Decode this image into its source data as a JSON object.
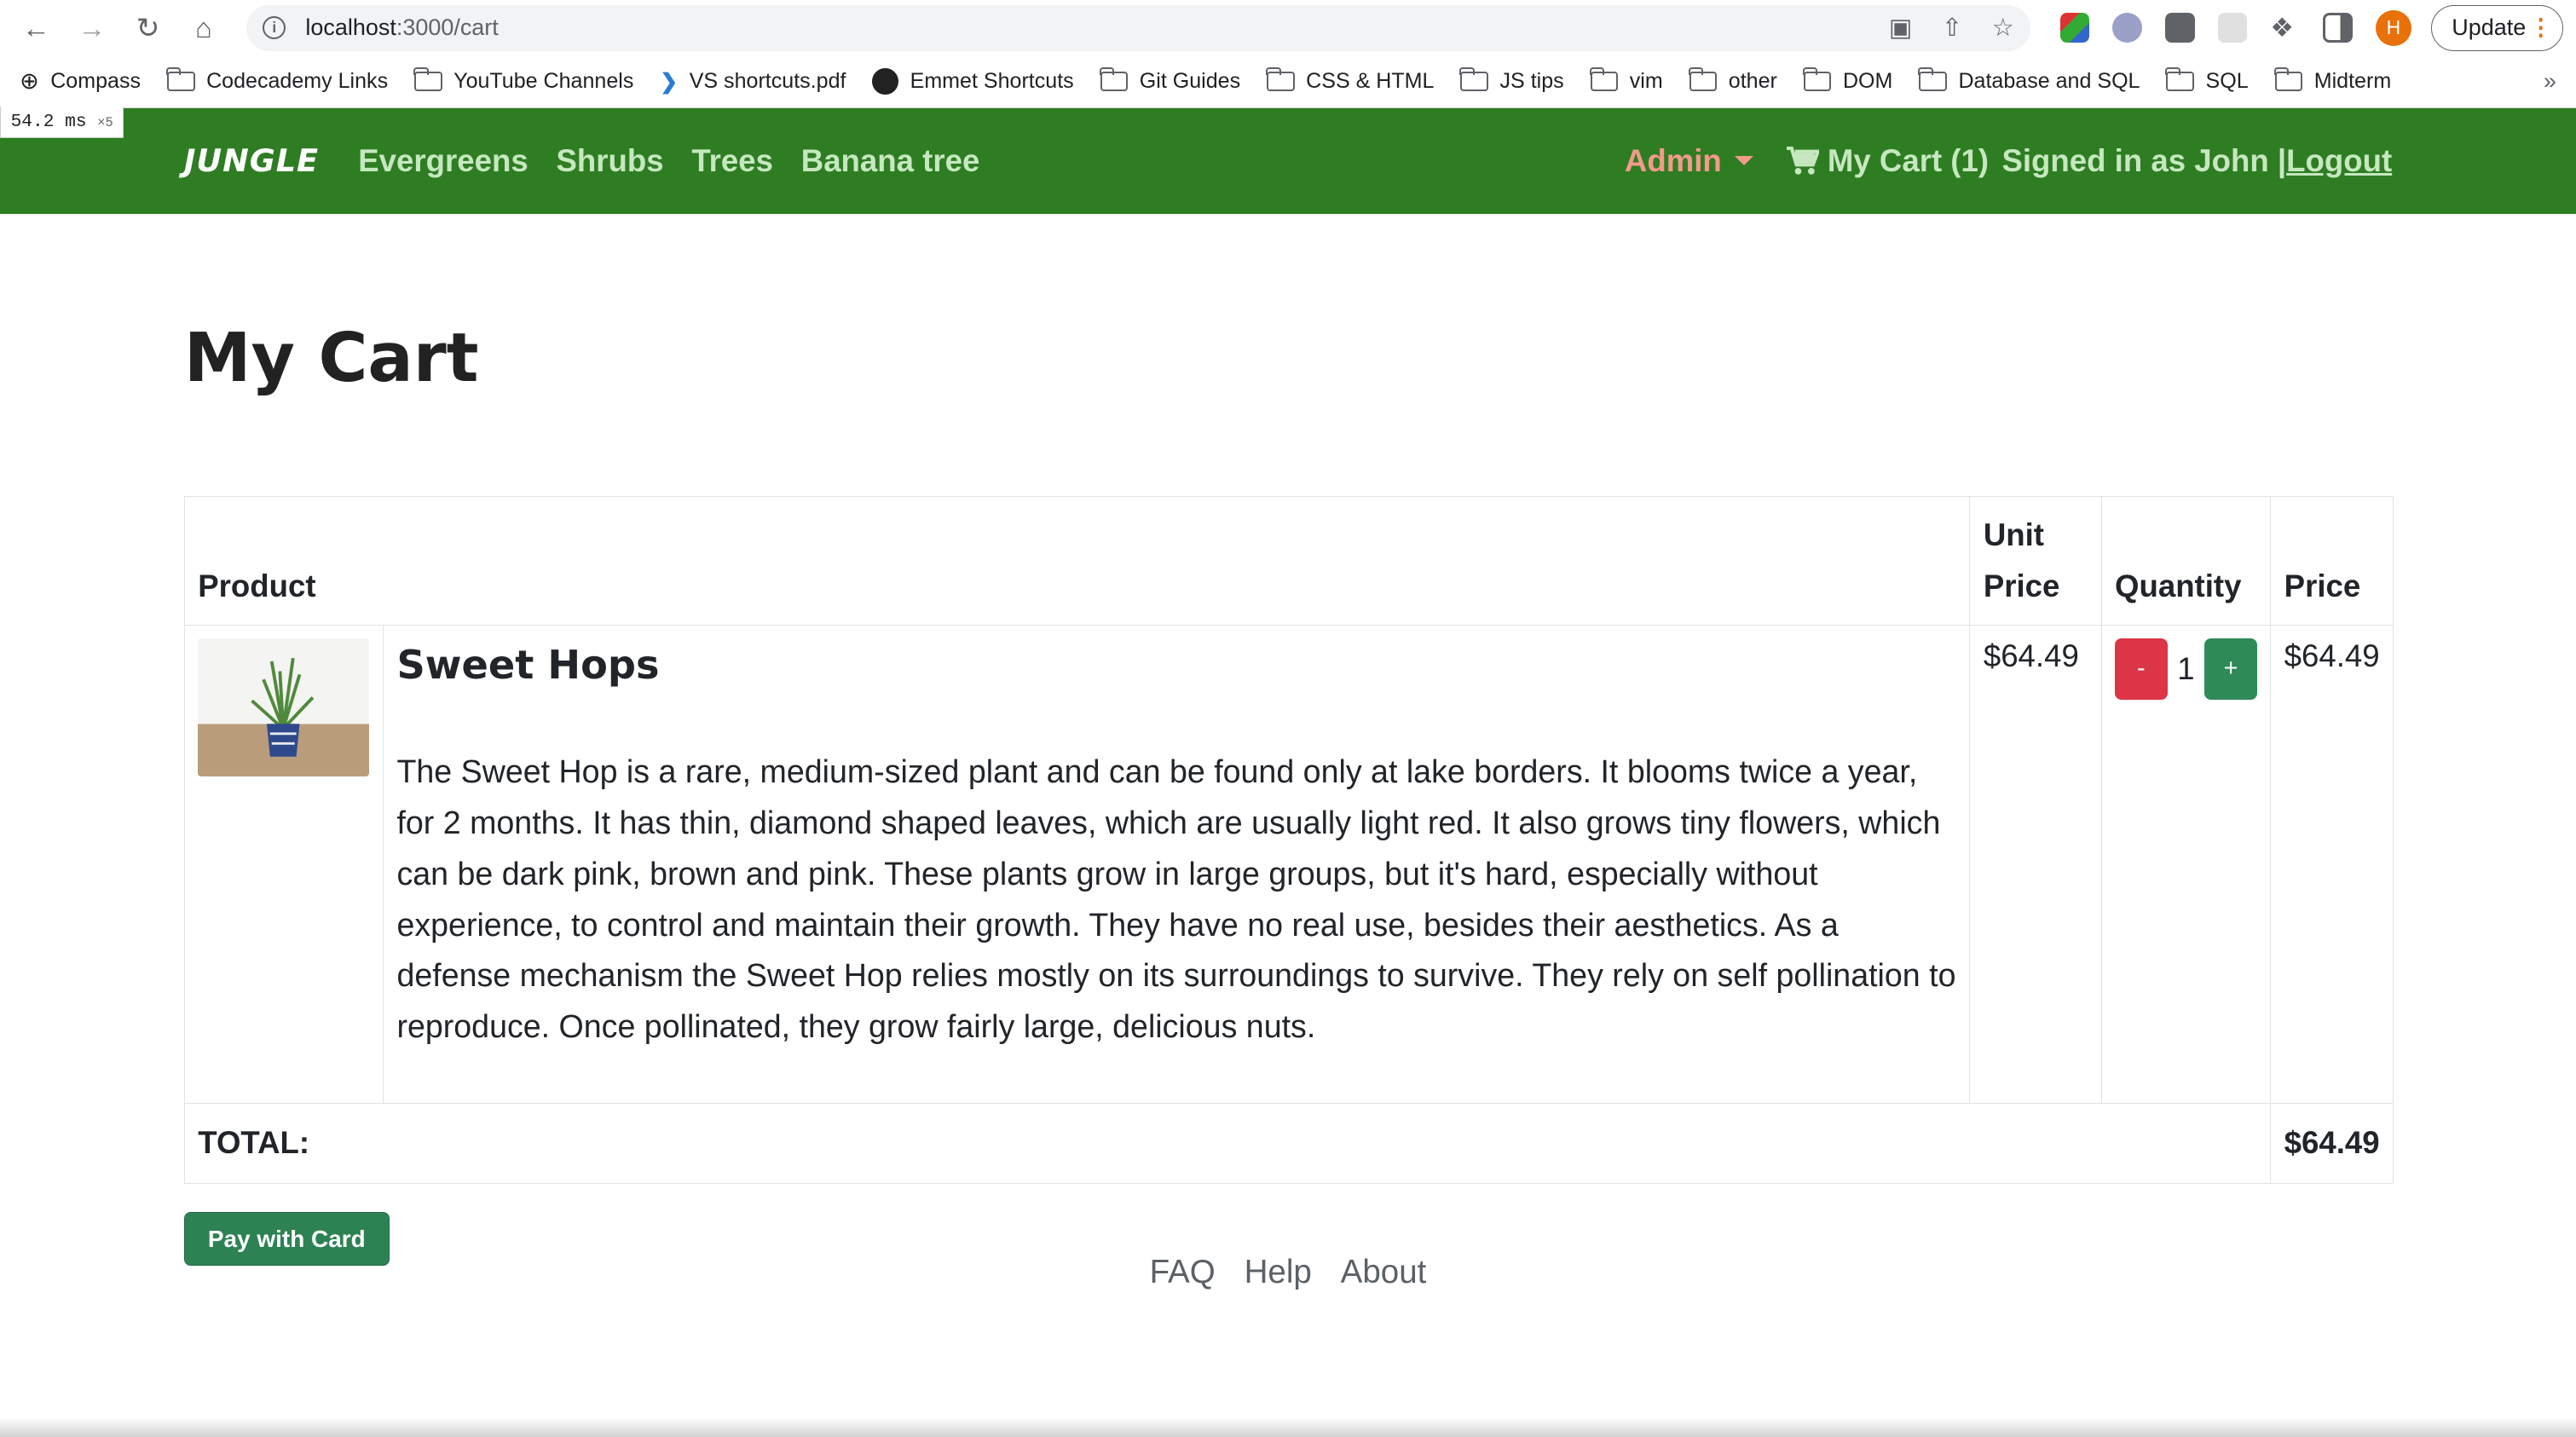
{
  "browser": {
    "url_host": "localhost",
    "url_path": ":3000/cart",
    "update_label": "Update",
    "avatar_initial": "H",
    "bookmarks": [
      "Compass",
      "Codecademy Links",
      "YouTube Channels",
      "VS shortcuts.pdf",
      "Emmet Shortcuts",
      "Git Guides",
      "CSS & HTML",
      "JS tips",
      "vim",
      "other",
      "DOM",
      "Database and SQL",
      "SQL",
      "Midterm"
    ],
    "more": "»"
  },
  "perf": {
    "value": "54.2",
    "unit": "ms",
    "mult": "×5"
  },
  "nav": {
    "brand": "JUNGLE",
    "links": [
      "Evergreens",
      "Shrubs",
      "Trees",
      "Banana tree"
    ],
    "admin": "Admin",
    "cart": "My Cart (1)",
    "signed_in": "Signed in as John |",
    "logout": "Logout"
  },
  "page": {
    "title": "My Cart"
  },
  "cart": {
    "headers": {
      "product": "Product",
      "unit_price_1": "Unit",
      "unit_price_2": "Price",
      "quantity": "Quantity",
      "price": "Price"
    },
    "item": {
      "name": "Sweet Hops",
      "description": "The Sweet Hop is a rare, medium-sized plant and can be found only at lake borders. It blooms twice a year, for 2 months. It has thin, diamond shaped leaves, which are usually light red. It also grows tiny flowers, which can be dark pink, brown and pink. These plants grow in large groups, but it's hard, especially without experience, to control and maintain their growth. They have no real use, besides their aesthetics. As a defense mechanism the Sweet Hop relies mostly on its surroundings to survive. They rely on self pollination to reproduce. Once pollinated, they grow fairly large, delicious nuts.",
      "unit_price": "$64.49",
      "quantity": "1",
      "price": "$64.49"
    },
    "total_label": "TOTAL:",
    "total": "$64.49",
    "minus": "-",
    "plus": "+"
  },
  "pay_button": "Pay with Card",
  "footer": [
    "FAQ",
    "Help",
    "About"
  ]
}
